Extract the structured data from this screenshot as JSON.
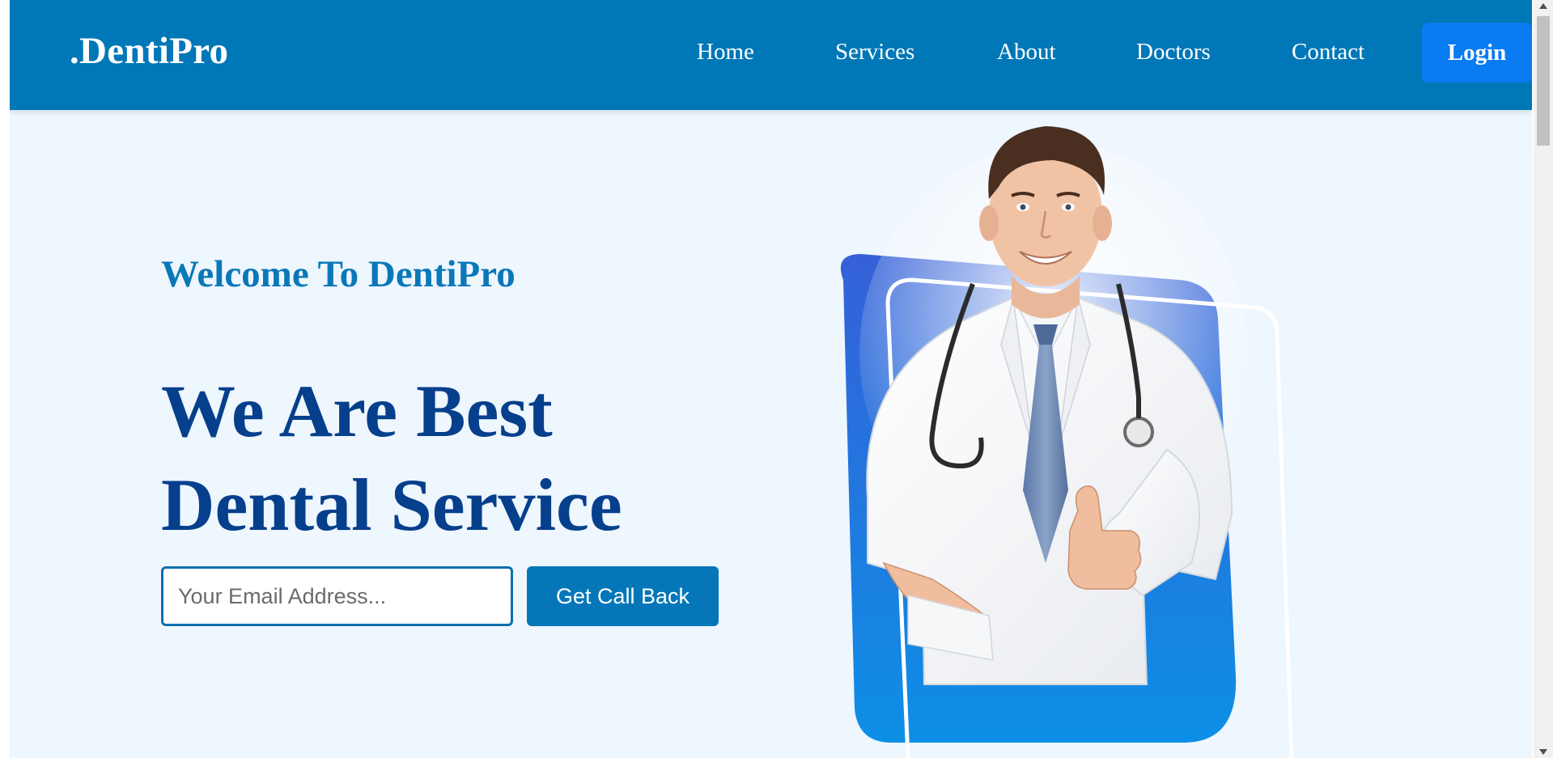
{
  "brand": {
    "name": ".DentiPro"
  },
  "nav": {
    "links": [
      {
        "label": "Home"
      },
      {
        "label": "Services"
      },
      {
        "label": "About"
      },
      {
        "label": "Doctors"
      },
      {
        "label": "Contact"
      }
    ],
    "login_label": "Login"
  },
  "hero": {
    "welcome": "Welcome To DentiPro",
    "headline_line1": "We Are Best",
    "headline_line2": "Dental Service",
    "email_placeholder": "Your Email Address...",
    "email_value": "",
    "callback_label": "Get Call Back"
  },
  "colors": {
    "navbar": "#0077b6",
    "page_background": "#eef6fe",
    "login_button": "#0a7cf2",
    "welcome_text": "#0a78b8",
    "headline_text": "#063f8c",
    "callback_button": "#0577b8"
  },
  "icons": {
    "hero_image": "doctor-thumbs-up-illustration"
  }
}
